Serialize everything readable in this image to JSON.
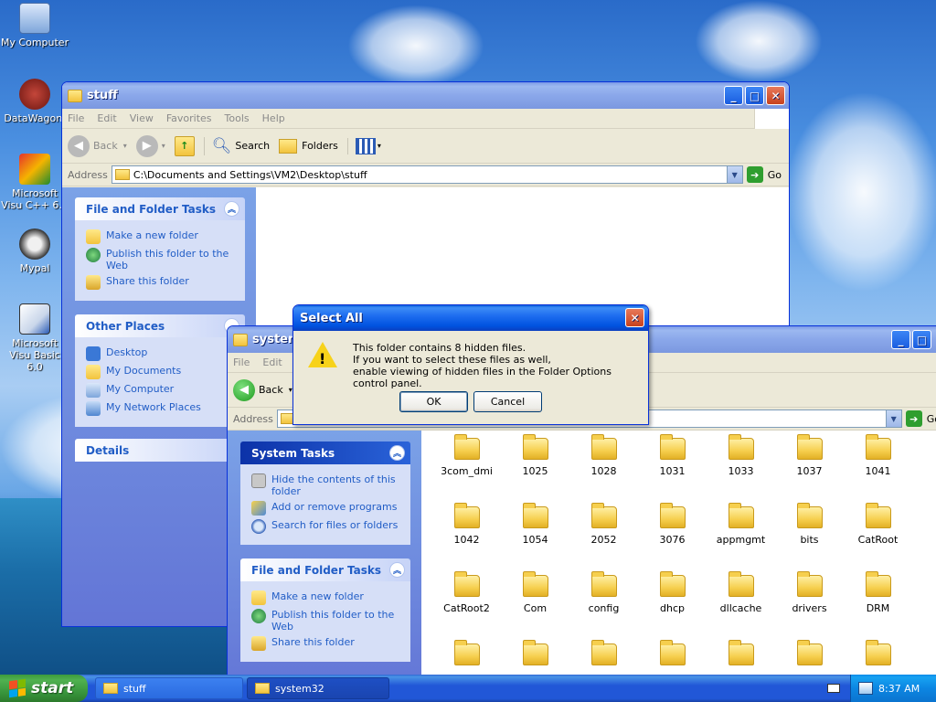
{
  "desktop": {
    "icons": [
      {
        "label": "My Computer"
      },
      {
        "label": "DataWagon."
      },
      {
        "label": "Microsoft Visu C++ 6.0"
      },
      {
        "label": "Mypal"
      },
      {
        "label": "Microsoft Visu Basic 6.0"
      }
    ]
  },
  "stuff_window": {
    "title": "stuff",
    "menu": [
      "File",
      "Edit",
      "View",
      "Favorites",
      "Tools",
      "Help"
    ],
    "toolbar": {
      "back": "Back",
      "search": "Search",
      "folders": "Folders"
    },
    "address_label": "Address",
    "address_value": "C:\\Documents and Settings\\VM2\\Desktop\\stuff",
    "go": "Go",
    "file_folder_tasks": {
      "title": "File and Folder Tasks",
      "items": [
        "Make a new folder",
        "Publish this folder to the Web",
        "Share this folder"
      ]
    },
    "other_places": {
      "title": "Other Places",
      "items": [
        "Desktop",
        "My Documents",
        "My Computer",
        "My Network Places"
      ]
    },
    "details": {
      "title": "Details"
    }
  },
  "system32_window": {
    "title": "system32",
    "menu": [
      "File",
      "Edit"
    ],
    "toolbar": {
      "back": "Back"
    },
    "address_label": "Address",
    "go": "Go",
    "system_tasks": {
      "title": "System Tasks",
      "items": [
        "Hide the contents of this folder",
        "Add or remove programs",
        "Search for files or folders"
      ]
    },
    "file_folder_tasks": {
      "title": "File and Folder Tasks",
      "items": [
        "Make a new folder",
        "Publish this folder to the Web",
        "Share this folder"
      ]
    },
    "folders": [
      "3com_dmi",
      "1025",
      "1028",
      "1031",
      "1033",
      "1037",
      "1041",
      "1042",
      "1054",
      "2052",
      "3076",
      "appmgmt",
      "bits",
      "CatRoot",
      "CatRoot2",
      "Com",
      "config",
      "dhcp",
      "dllcache",
      "drivers",
      "DRM"
    ]
  },
  "dialog": {
    "title": "Select All",
    "message_line1": "This folder contains 8 hidden files.",
    "message_line2": "If you want to select these files as well,",
    "message_line3": "enable viewing of hidden files in the Folder Options control panel.",
    "ok": "OK",
    "cancel": "Cancel"
  },
  "taskbar": {
    "start": "start",
    "tasks": [
      "stuff",
      "system32"
    ],
    "clock": "8:37 AM"
  }
}
